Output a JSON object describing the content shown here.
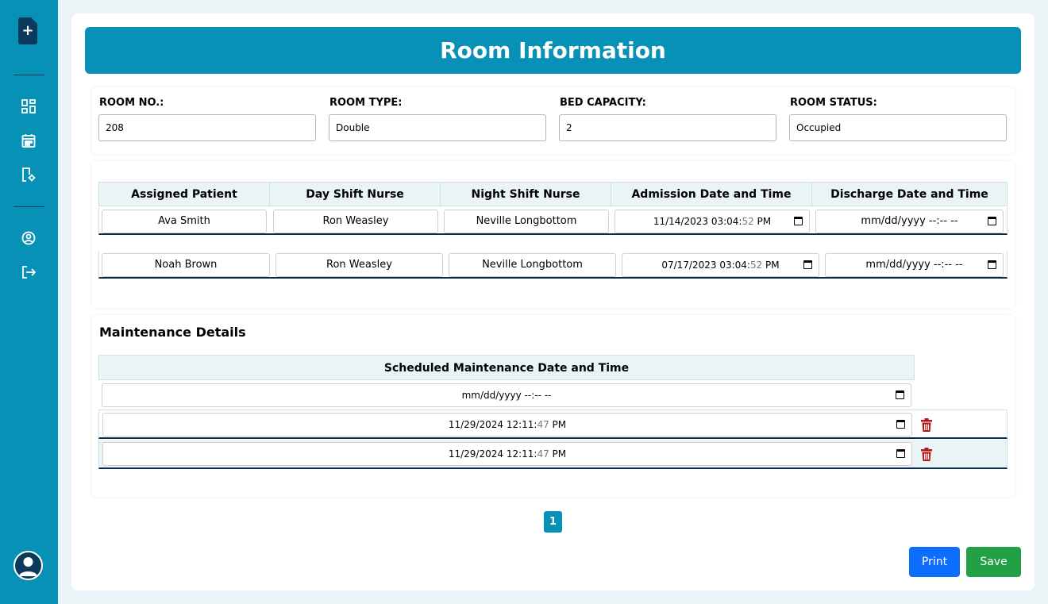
{
  "sidebar": {
    "logo_glyph": "+",
    "items": [
      {
        "name": "dashboard-icon"
      },
      {
        "name": "calendar-icon"
      },
      {
        "name": "room-settings-icon"
      },
      {
        "name": "profile-icon"
      },
      {
        "name": "logout-icon"
      }
    ],
    "avatar": "user-avatar-icon"
  },
  "header": {
    "title": "Room Information"
  },
  "room": {
    "number_label": "ROOM NO.:",
    "number_value": "208",
    "type_label": "ROOM TYPE:",
    "type_value": "Double",
    "capacity_label": "BED CAPACITY:",
    "capacity_value": "2",
    "status_label": "ROOM STATUS:",
    "status_value": "Occupied"
  },
  "patients": {
    "headers": [
      "Assigned Patient",
      "Day Shift Nurse",
      "Night Shift Nurse",
      "Admission Date and Time",
      "Discharge Date and Time"
    ],
    "rows": [
      {
        "patient": "Ava Smith",
        "day_nurse": "Ron Weasley",
        "night_nurse": "Neville Longbottom",
        "admission_main": "11/14/2023 03:04:",
        "admission_sec": "52",
        "admission_ampm": " PM",
        "discharge": "mm/dd/yyyy --:-- --"
      },
      {
        "patient": "Noah Brown",
        "day_nurse": "Ron Weasley",
        "night_nurse": "Neville Longbottom",
        "admission_main": "07/17/2023 03:04:",
        "admission_sec": "52",
        "admission_ampm": " PM",
        "discharge": "mm/dd/yyyy --:-- --"
      }
    ]
  },
  "maintenance": {
    "title": "Maintenance Details",
    "header": "Scheduled Maintenance Date and Time",
    "new_placeholder": "mm/dd/yyyy --:-- --",
    "rows": [
      {
        "main": "11/29/2024 12:11:",
        "sec": "47",
        "ampm": " PM"
      },
      {
        "main": "11/29/2024 12:11:",
        "sec": "47",
        "ampm": " PM"
      }
    ]
  },
  "pagination": {
    "current": "1"
  },
  "actions": {
    "print": "Print",
    "save": "Save"
  },
  "colors": {
    "primary": "#0891b6",
    "navy": "#0b3a5c",
    "print": "#0d6efd",
    "save": "#22a045",
    "delete": "#b01818"
  }
}
